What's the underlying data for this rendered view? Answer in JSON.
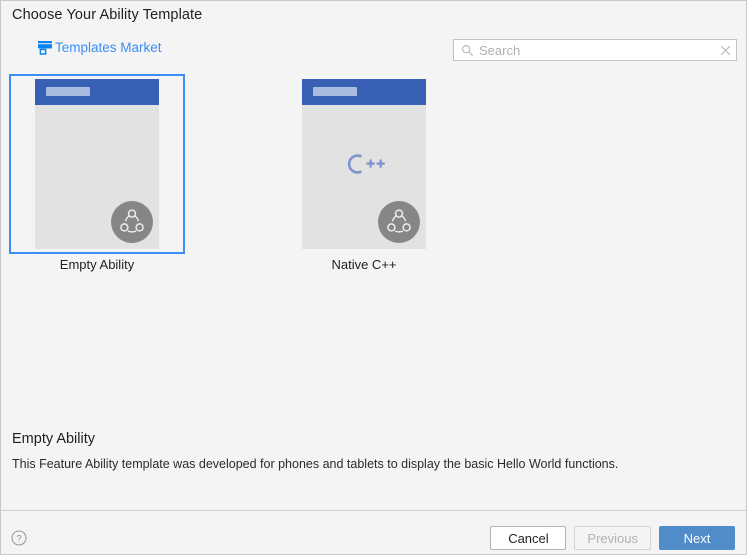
{
  "header": {
    "title": "Choose Your Ability Template",
    "market_link_label": "Templates Market",
    "market_icon": "shop-icon"
  },
  "search": {
    "placeholder": "Search",
    "value": "",
    "icon": "search-icon",
    "clear_icon": "close-icon"
  },
  "templates": [
    {
      "label": "Empty Ability",
      "selected": true,
      "thumbnail": {
        "header_color": "#3861b6",
        "body_color": "#e2e2e2",
        "center_glyph": "",
        "badge_icon": "ability-badge-icon"
      }
    },
    {
      "label": "Native C++",
      "selected": false,
      "thumbnail": {
        "header_color": "#3861b6",
        "body_color": "#e2e2e2",
        "center_glyph": "C++",
        "badge_icon": "ability-badge-icon"
      }
    }
  ],
  "description": {
    "title": "Empty Ability",
    "text": "This Feature Ability template was developed for phones and tablets to display the basic Hello World functions."
  },
  "footer": {
    "help_icon": "help-circle-icon",
    "cancel_label": "Cancel",
    "previous_label": "Previous",
    "previous_disabled": true,
    "next_label": "Next"
  },
  "colors": {
    "accent_blue": "#3c8ef5",
    "primary_button": "#4f8cc9",
    "thumb_header": "#3861b6",
    "background": "#f4f4f4"
  }
}
